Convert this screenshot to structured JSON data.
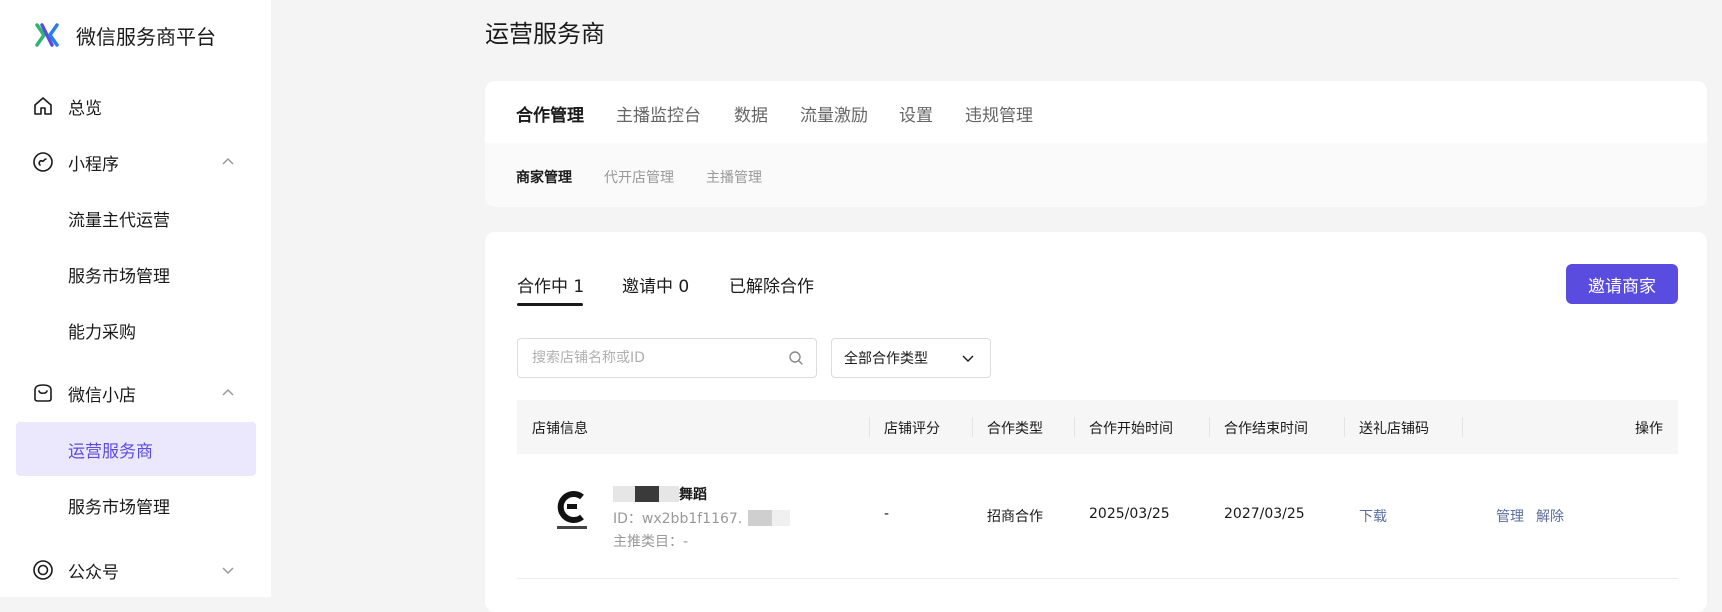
{
  "sidebar": {
    "brand_title": "微信服务商平台",
    "items": [
      {
        "label": "总览",
        "icon": "home-icon"
      },
      {
        "label": "小程序",
        "icon": "mini-program-icon",
        "expanded": true
      },
      {
        "label": "流量主代运营"
      },
      {
        "label": "服务市场管理"
      },
      {
        "label": "能力采购"
      },
      {
        "label": "微信小店",
        "icon": "shop-icon",
        "expanded": true
      },
      {
        "label": "运营服务商",
        "active": true
      },
      {
        "label": "服务市场管理"
      },
      {
        "label": "公众号",
        "icon": "official-account-icon",
        "expanded": false
      }
    ]
  },
  "page": {
    "title": "运营服务商"
  },
  "main_tabs": [
    "合作管理",
    "主播监控台",
    "数据",
    "流量激励",
    "设置",
    "违规管理"
  ],
  "sub_tabs": [
    "商家管理",
    "代开店管理",
    "主播管理"
  ],
  "coop_tabs": [
    "合作中 1",
    "邀请中 0",
    "已解除合作"
  ],
  "invite_button": "邀请商家",
  "search": {
    "placeholder": "搜索店铺名称或ID",
    "value": ""
  },
  "filter": {
    "selected": "全部合作类型"
  },
  "table": {
    "headers": [
      "店铺信息",
      "店铺评分",
      "合作类型",
      "合作开始时间",
      "合作结束时间",
      "送礼店铺码",
      "操作"
    ],
    "rows": [
      {
        "shop_name_suffix": "舞蹈",
        "shop_id": "ID：wx2bb1f1167.",
        "category": "主推类目：-",
        "rating": "-",
        "coop_type": "招商合作",
        "start": "2025/03/25",
        "end": "2027/03/25",
        "gift_code": "下载",
        "actions": [
          "管理",
          "解除"
        ]
      }
    ]
  },
  "colors": {
    "accent": "#5b4ce0",
    "active_bg": "#ebe8fe",
    "link": "#5b6d9e"
  }
}
